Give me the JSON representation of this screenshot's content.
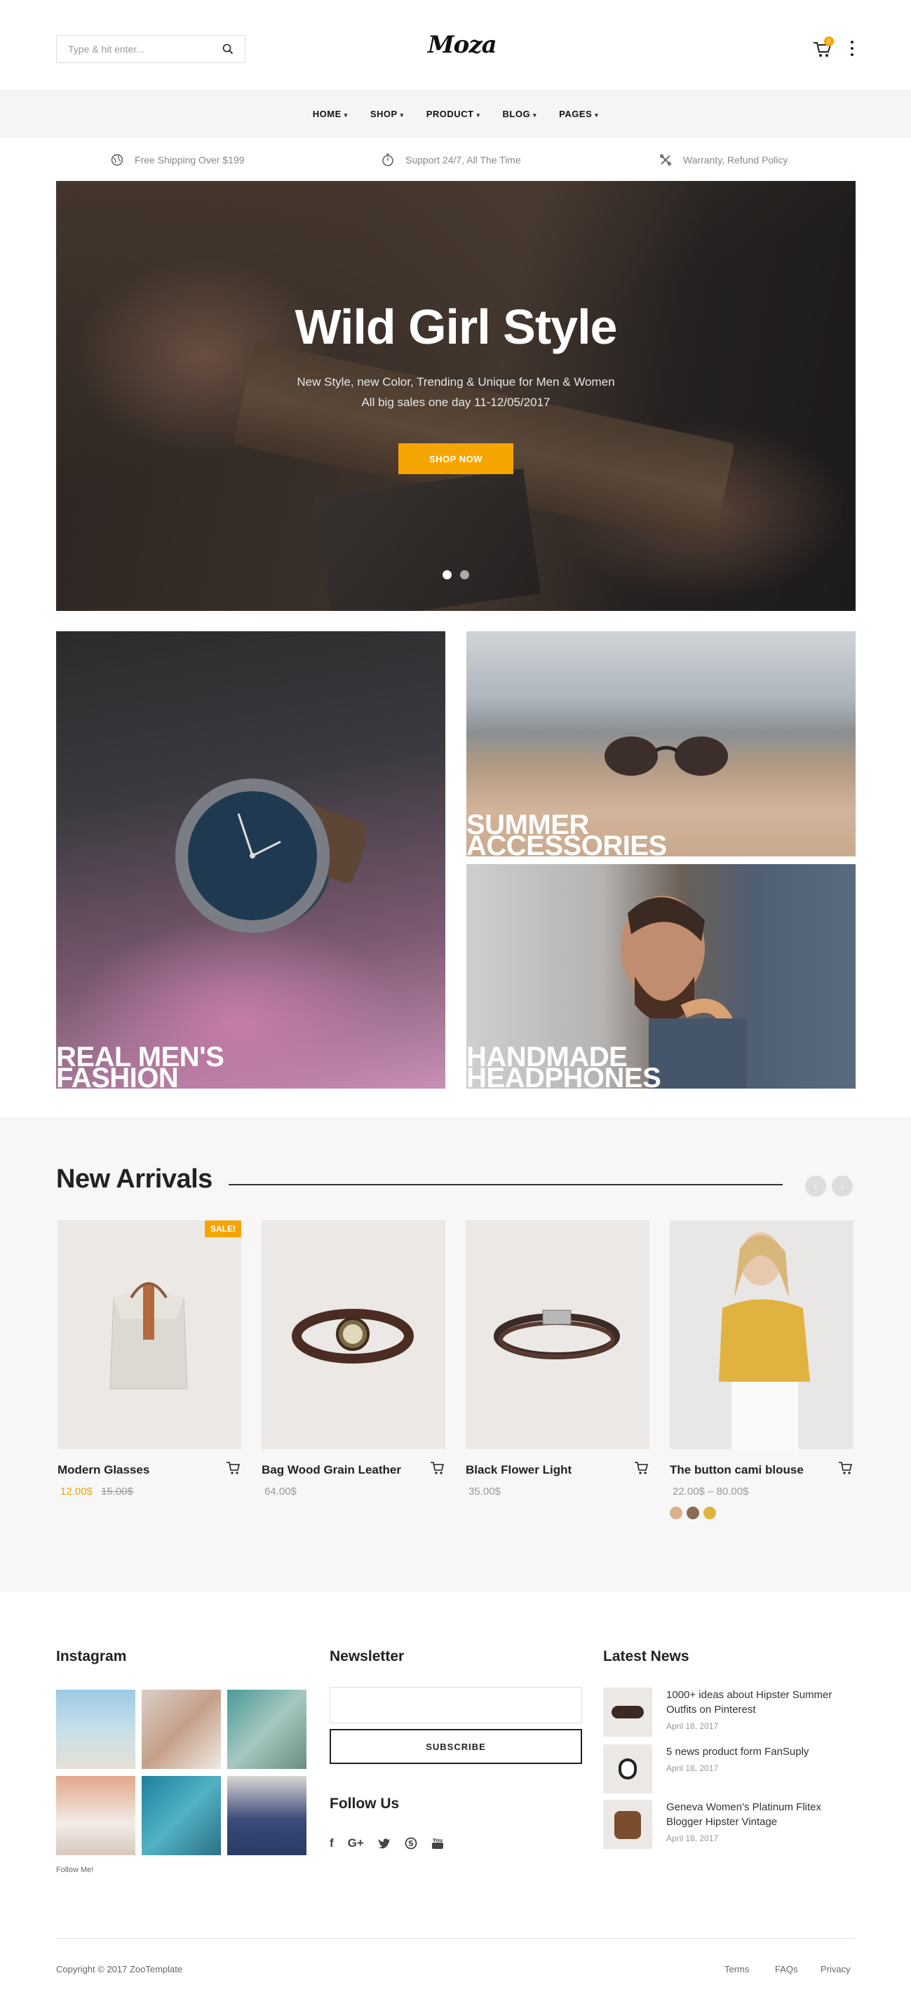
{
  "header": {
    "search_placeholder": "Type & hit enter...",
    "logo": "Moza",
    "cart_count": "0"
  },
  "nav": [
    {
      "label": "HOME"
    },
    {
      "label": "SHOP"
    },
    {
      "label": "PRODUCT"
    },
    {
      "label": "BLOG"
    },
    {
      "label": "PAGES"
    }
  ],
  "features": [
    {
      "icon": "globe-icon",
      "label": "Free Shipping Over $199"
    },
    {
      "icon": "stopwatch-icon",
      "label": "Support 24/7, All The Time"
    },
    {
      "icon": "tools-icon",
      "label": "Warranty, Refund Policy"
    }
  ],
  "hero": {
    "title": "Wild Girl Style",
    "subtitle_line1": "New Style, new Color, Trending & Unique for Men & Women",
    "subtitle_line2": "All big sales one day 11-12/05/2017",
    "button": "SHOP NOW",
    "slides": 2,
    "active_slide": 1
  },
  "banners": {
    "left_line1": "REAL MEN'S",
    "left_line2": "FASHION",
    "top_right_line1": "SUMMER",
    "top_right_line2": "ACCESSORIES",
    "bottom_right_line1": "HANDMADE",
    "bottom_right_line2": "HEADPHONES"
  },
  "arrivals": {
    "title": "New Arrivals",
    "prev": "‹",
    "next": "›",
    "products": [
      {
        "name": "Modern Glasses",
        "price": "12.00$",
        "old_price": "15.00$",
        "badge": "SALE!"
      },
      {
        "name": "Bag Wood Grain Leather",
        "price": "64.00$"
      },
      {
        "name": "Black Flower Light",
        "price": "35.00$"
      },
      {
        "name": "The button cami blouse",
        "price": "22.00$  –  80.00$"
      }
    ]
  },
  "footer": {
    "instagram_title": "Instagram",
    "follow_me": "Follow Me!",
    "newsletter_title": "Newsletter",
    "subscribe": "SUBSCRIBE",
    "follow_us": "Follow Us",
    "latest_news_title": "Latest News",
    "news": [
      {
        "title": "1000+ ideas about Hipster Summer Outfits on Pinterest",
        "date": "April 18, 2017"
      },
      {
        "title": "5 news product form FanSuply",
        "date": "April 18, 2017"
      },
      {
        "title": "Geneva Women's Platinum Flitex Blogger Hipster Vintage",
        "date": "April 18, 2017"
      }
    ],
    "copyright": "Copyright © 2017 ZooTemplate",
    "links": [
      "Terms",
      "FAQs",
      "Privacy"
    ]
  },
  "colors": {
    "accent": "#f6a500",
    "text_dark": "#222222",
    "muted": "#999999"
  }
}
